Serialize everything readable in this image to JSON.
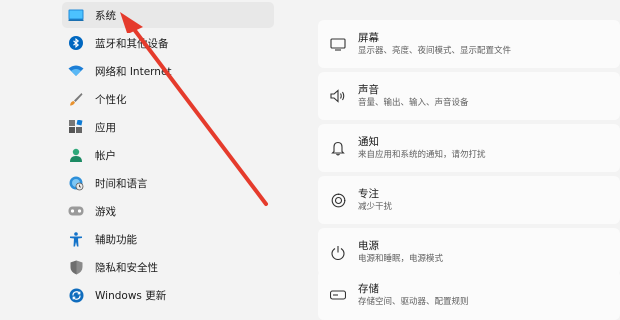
{
  "sidebar": {
    "items": [
      {
        "label": "系统",
        "icon": "monitor-icon"
      },
      {
        "label": "蓝牙和其他设备",
        "icon": "bluetooth-icon"
      },
      {
        "label": "网络和 Internet",
        "icon": "wifi-icon"
      },
      {
        "label": "个性化",
        "icon": "brush-icon"
      },
      {
        "label": "应用",
        "icon": "apps-icon"
      },
      {
        "label": "帐户",
        "icon": "person-icon"
      },
      {
        "label": "时间和语言",
        "icon": "globe-clock-icon"
      },
      {
        "label": "游戏",
        "icon": "gamepad-icon"
      },
      {
        "label": "辅助功能",
        "icon": "accessibility-icon"
      },
      {
        "label": "隐私和安全性",
        "icon": "shield-icon"
      },
      {
        "label": "Windows 更新",
        "icon": "update-icon"
      }
    ]
  },
  "settings": [
    {
      "title": "屏幕",
      "subtitle": "显示器、亮度、夜间模式、显示配置文件",
      "icon": "display-icon"
    },
    {
      "title": "声音",
      "subtitle": "音量、输出、输入、声音设备",
      "icon": "speaker-icon"
    },
    {
      "title": "通知",
      "subtitle": "来自应用和系统的通知，请勿打扰",
      "icon": "bell-icon"
    },
    {
      "title": "专注",
      "subtitle": "减少干扰",
      "icon": "focus-icon"
    },
    {
      "title": "电源",
      "subtitle": "电源和睡眠，电源模式",
      "icon": "power-icon"
    },
    {
      "title": "存储",
      "subtitle": "存储空间、驱动器、配置规则",
      "icon": "storage-icon"
    }
  ],
  "colors": {
    "accent": "#0067c0",
    "arrow": "#e53b2c"
  }
}
